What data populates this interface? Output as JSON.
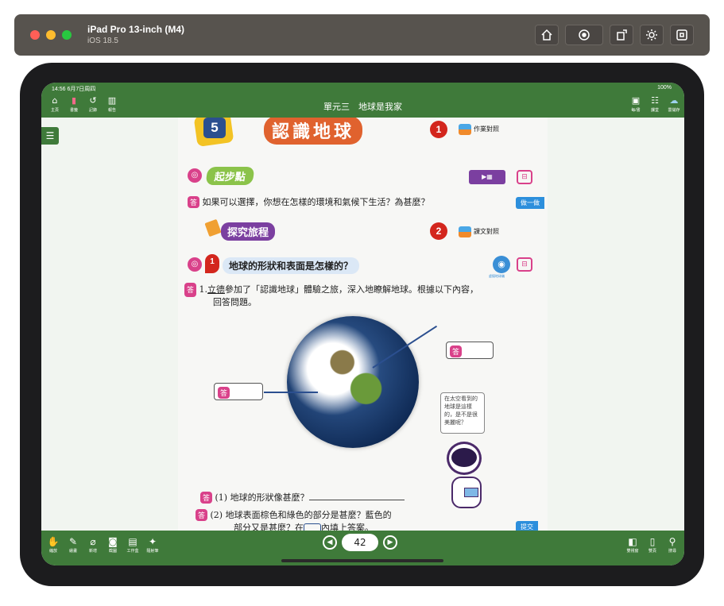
{
  "simulator": {
    "device_name": "iPad Pro 13-inch (M4)",
    "os_version": "iOS 18.5",
    "buttons": [
      "home-icon",
      "screenshot-icon",
      "rotate-icon",
      "brightness-icon",
      "command-icon"
    ]
  },
  "status": {
    "time": "14:56  6月7日周四",
    "battery": "100%"
  },
  "topbar": {
    "title": "單元三　地球是我家",
    "left": [
      {
        "icon": "home-icon",
        "label": "主頁"
      },
      {
        "icon": "bookmark-icon",
        "label": "書籤"
      },
      {
        "icon": "history-icon",
        "label": "記錄"
      },
      {
        "icon": "report-icon",
        "label": "報告"
      }
    ],
    "right": [
      {
        "icon": "book-icon",
        "label": "每/書"
      },
      {
        "icon": "classroom-icon",
        "label": "課堂"
      },
      {
        "icon": "cloud-icon",
        "label": "雲儲存"
      }
    ]
  },
  "content": {
    "unit_number": "5",
    "unit_title": "認識地球",
    "badge1": "1",
    "homework_label": "作業對照",
    "start_label": "起步點",
    "answer_tag": "答",
    "question_intro": "如果可以選擇，你想在怎樣的環境和氣候下生活？為甚麼？",
    "do_it": "做一做",
    "explore_label": "探究旅程",
    "badge2": "2",
    "text_label": "課文對照",
    "section_num": "1",
    "section_heading": "地球的形狀和表面是怎樣的？",
    "virtual_label": "虛擬地球儀",
    "q1_num": "1.",
    "q1_name": "立德",
    "q1_text": "參加了「認識地球」體驗之旅，深入地瞭解地球。根據以下內容，",
    "q1_text2": "回答問題。",
    "callout": "在太空看到的地球是這樣的，是不是很美麗呢？",
    "sub1": "(1) 地球的形狀像甚麼？",
    "sub2a": "(2) 地球表面棕色和綠色的部分是甚麼？藍色的",
    "sub2b": "部分又是甚麼？在",
    "sub2c": "內填上答案。",
    "submit": "提交"
  },
  "bottombar": {
    "left": [
      {
        "icon": "hand-icon",
        "label": "縮放"
      },
      {
        "icon": "pen-icon",
        "label": "繪畫"
      },
      {
        "icon": "paperclip-icon",
        "label": "新增"
      },
      {
        "icon": "camera-icon",
        "label": "截圖"
      },
      {
        "icon": "toolbox-icon",
        "label": "工作盒"
      },
      {
        "icon": "magic-icon",
        "label": "隨射筆"
      }
    ],
    "page": "42",
    "right": [
      {
        "icon": "dual-icon",
        "label": "雙視窗"
      },
      {
        "icon": "pages-icon",
        "label": "雙頁"
      },
      {
        "icon": "search-icon",
        "label": "搜尋"
      }
    ]
  },
  "colors": {
    "brand_green": "#3f7a3a",
    "answer_pink": "#d9418a",
    "badge_red": "#d3261d",
    "tab_blue": "#2d8fdc"
  }
}
